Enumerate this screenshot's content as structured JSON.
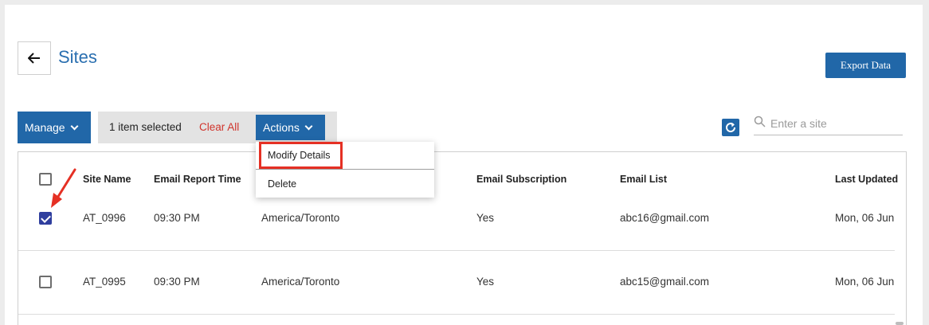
{
  "header": {
    "title": "Sites",
    "export_label": "Export Data"
  },
  "toolbar": {
    "manage_label": "Manage",
    "selection_count": "1 item selected",
    "clear_all_label": "Clear All",
    "actions_label": "Actions",
    "search_placeholder": "Enter a site",
    "search_value": ""
  },
  "actions_menu": {
    "items": [
      {
        "label": "Modify Details",
        "highlighted": true
      },
      {
        "label": "Delete",
        "highlighted": false
      }
    ]
  },
  "table": {
    "columns": [
      "Site Name",
      "Email Report Time",
      "Email Subscription",
      "Email List",
      "Last Updated"
    ],
    "rows": [
      {
        "checked": true,
        "site_name": "AT_0996",
        "report_time": "09:30 PM",
        "timezone": "America/Toronto",
        "subscription": "Yes",
        "email_list": "abc16@gmail.com",
        "last_updated": "Mon, 06 Jun"
      },
      {
        "checked": false,
        "site_name": "AT_0995",
        "report_time": "09:30 PM",
        "timezone": "America/Toronto",
        "subscription": "Yes",
        "email_list": "abc15@gmail.com",
        "last_updated": "Mon, 06 Jun"
      }
    ]
  },
  "icons": {
    "back": "arrow-left-icon",
    "manage_caret": "chevron-down-icon",
    "actions_caret": "chevron-down-icon",
    "refresh": "refresh-icon",
    "search": "search-icon",
    "annotation": "red-arrow-icon"
  },
  "colors": {
    "accent": "#2167a8",
    "title_blue": "#2a6fb0",
    "clear_all_red": "#d0342c",
    "checkbox_checked": "#2f3e9e",
    "highlight_red": "#e53024"
  }
}
